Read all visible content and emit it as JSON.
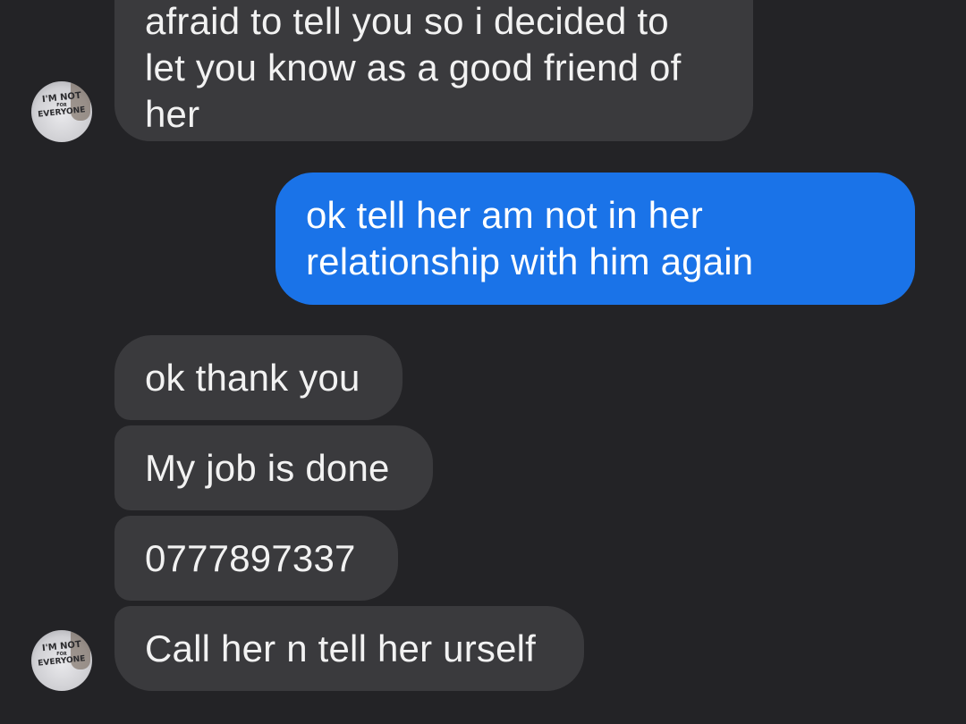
{
  "messages": [
    {
      "id": "msg-0",
      "direction": "incoming",
      "text": "afraid to tell you so i decided to\nlet you know as a good friend of\nher"
    },
    {
      "id": "msg-1",
      "direction": "outgoing",
      "text": "ok tell her am not in her\nrelationship  with him  again"
    },
    {
      "id": "msg-2",
      "direction": "incoming",
      "text": "ok thank you"
    },
    {
      "id": "msg-3",
      "direction": "incoming",
      "text": "My job is done"
    },
    {
      "id": "msg-4",
      "direction": "incoming",
      "text": "0777897337"
    },
    {
      "id": "msg-5",
      "direction": "incoming",
      "text": "Call her n tell her urself"
    }
  ],
  "avatar": {
    "line1": "I'M NOT",
    "line2": "FOR",
    "line3": "EVERYONE"
  },
  "colors": {
    "background": "#232326",
    "incoming_bubble": "#3a3a3d",
    "outgoing_bubble": "#1a73e8",
    "text": "#ffffff"
  }
}
